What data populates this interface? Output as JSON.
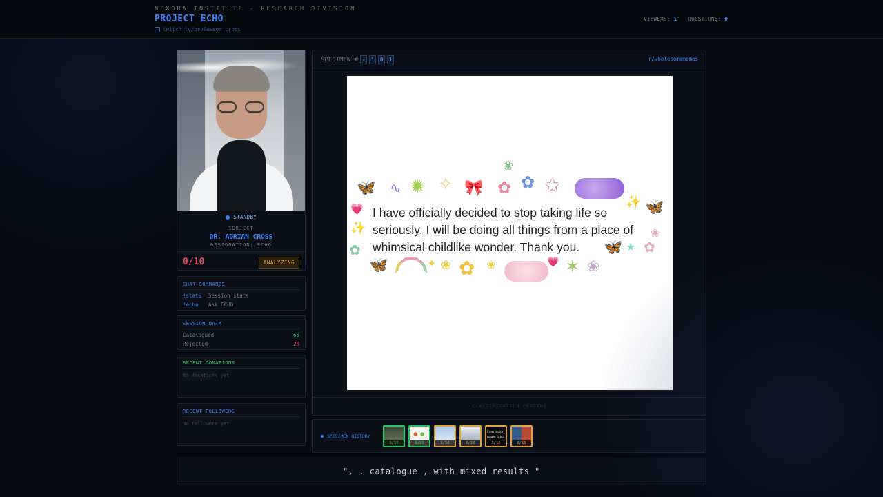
{
  "header": {
    "org": "NEXORA INSTITUTE - RESEARCH DIVISION",
    "title": "PROJECT ECHO",
    "link": "twitch.tv/professor_cross",
    "viewers_label": "VIEWERS:",
    "viewers": "1",
    "questions_label": "QUESTIONS:",
    "questions": "0"
  },
  "profile": {
    "status": "STANDBY",
    "subject_label": "SUBJECT",
    "name": "DR. ADRIAN CROSS",
    "designation": "DESIGNATION: ECHO",
    "score": "0/10",
    "state": "ANALYZING"
  },
  "commands": {
    "title": "CHAT COMMANDS",
    "items": [
      {
        "cmd": "!stats",
        "desc": "Session stats"
      },
      {
        "cmd": "!echo",
        "desc": "Ask ECHO"
      }
    ]
  },
  "session": {
    "title": "SESSION DATA",
    "catalogued_label": "Catalogued",
    "catalogued": "65",
    "rejected_label": "Rejected",
    "rejected": "28"
  },
  "donations": {
    "title": "RECENT DONATIONS",
    "empty": "No donations yet"
  },
  "followers": {
    "title": "RECENT FOLLOWERS",
    "empty": "No followers yet"
  },
  "viewer": {
    "specimen_label": "SPECIMEN #",
    "digits": [
      "-",
      "1",
      "0",
      "1"
    ],
    "subreddit": "r/wholesomememes",
    "meme_text": "I have officially decided to stop taking life so seriously. I will be doing all things from a place of whimsical childlike wonder. Thank you.",
    "pending": "CLASSIFICATION PENDING"
  },
  "history": {
    "label": "SPECIMEN HISTORY",
    "items": [
      {
        "score": "9/10",
        "color": "#22c55e",
        "thumb_text": ""
      },
      {
        "score": "8/10",
        "color": "#22c55e",
        "thumb_text": ""
      },
      {
        "score": "5/10",
        "color": "#e0a23a",
        "thumb_text": ""
      },
      {
        "score": "6/10",
        "color": "#e0a23a",
        "thumb_text": ""
      },
      {
        "score": "5/10",
        "color": "#e0a23a",
        "thumb_text": "I am lookin page, it wa"
      },
      {
        "score": "6/10",
        "color": "#e0a23a",
        "thumb_text": ""
      }
    ]
  },
  "quote": "\". . catalogue , with mixed results \"",
  "colors": {
    "accent": "#3b82f6",
    "good": "#22c55e",
    "bad": "#e4475d",
    "warn": "#e0a23a"
  }
}
